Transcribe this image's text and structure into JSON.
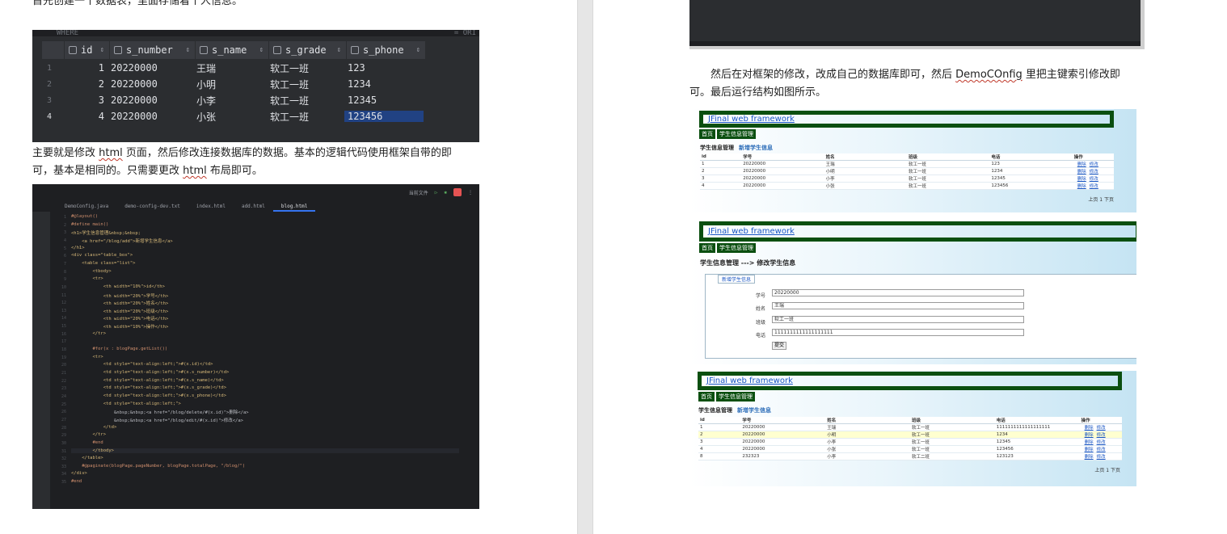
{
  "left_page": {
    "intro_text": "首先创建一个数据表，里面存储着个人信息。",
    "db_table": {
      "toolbar_text": "WHERE",
      "toolbar_right": "= ORI",
      "columns": [
        "id",
        "s_number",
        "s_name",
        "s_grade",
        "s_phone"
      ],
      "rows": [
        {
          "row": "1",
          "id": "1",
          "s_number": "20220000",
          "s_name": "王瑞",
          "s_grade": "软工一班",
          "s_phone": "123"
        },
        {
          "row": "2",
          "id": "2",
          "s_number": "20220000",
          "s_name": "小明",
          "s_grade": "软工一班",
          "s_phone": "1234"
        },
        {
          "row": "3",
          "id": "3",
          "s_number": "20220000",
          "s_name": "小李",
          "s_grade": "软工一班",
          "s_phone": "12345"
        },
        {
          "row": "4",
          "id": "4",
          "s_number": "20220000",
          "s_name": "小张",
          "s_grade": "软工一班",
          "s_phone": "123456"
        }
      ]
    },
    "para2": {
      "a": "主要就是修改 ",
      "b": "html",
      "c": " 页面，然后修改连接数据库的数据。基本的逻辑代码使用框架自带的即",
      "d": "可，基本是相同的。只需要更改 ",
      "e": "html",
      "f": " 布局即可。"
    },
    "ide": {
      "run_label": "当前文件",
      "tabs": [
        "DemoConfig.java",
        "demo-config-dev.txt",
        "index.html",
        "add.html",
        "blog.html"
      ],
      "lines": [
        "#@layout()",
        "#define main()",
        "<h1>学生信息管理&nbsp;&nbsp;",
        "    <a href=\"/blog/add\">新增学生信息</a>",
        "</h1>",
        "<div class=\"table_box\">",
        "    <table class=\"list\">",
        "        <tbody>",
        "        <tr>",
        "            <th width=\"10%\">id</th>",
        "            <th width=\"20%\">学号</th>",
        "            <th width=\"20%\">姓名</th>",
        "            <th width=\"20%\">班级</th>",
        "            <th width=\"20%\">电话</th>",
        "            <th width=\"10%\">操作</th>",
        "        </tr>",
        "",
        "        #for(x : blogPage.getList())",
        "        <tr>",
        "            <td style=\"text-align:left;\">#(x.id)</td>",
        "            <td style=\"text-align:left;\">#(x.s_number)</td>",
        "            <td style=\"text-align:left;\">#(x.s_name)</td>",
        "            <td style=\"text-align:left;\">#(x.s_grade)</td>",
        "            <td style=\"text-align:left;\">#(x.s_phone)</td>",
        "            <td style=\"text-align:left;\">",
        "                &nbsp;&nbsp;<a href=\"/blog/delete/#(x.id)\">删除</a>",
        "                &nbsp;&nbsp;<a href=\"/blog/edit/#(x.id)\">修改</a>",
        "            </td>",
        "        </tr>",
        "        #end",
        "        </tbody>",
        "    </table>",
        "    #@paginate(blogPage.pageNumber, blogPage.totalPage, \"/blog/\")",
        "</div>",
        "#end"
      ]
    }
  },
  "right_page": {
    "para": {
      "a": "然后在对框架的修改，改成自己的数据库即可，然后 ",
      "b": "DemoCOnfig",
      "c": " 里把主键索引修改即",
      "d": "可。最后运行结构如图所示。"
    },
    "brand": "JFinal web framework",
    "nav": [
      "首页",
      "学生信息管理"
    ],
    "list_title": "学生信息管理",
    "add_link": "新增学生信息",
    "headers": [
      "id",
      "学号",
      "姓名",
      "班级",
      "电话",
      "操作"
    ],
    "ops_delete": "删除",
    "ops_edit": "修改",
    "pager": "上页 1 下页",
    "shot1_rows": [
      [
        "1",
        "20220000",
        "王瑞",
        "软工一班",
        "123"
      ],
      [
        "2",
        "20220000",
        "小明",
        "软工一班",
        "1234"
      ],
      [
        "3",
        "20220000",
        "小李",
        "软工一班",
        "12345"
      ],
      [
        "4",
        "20220000",
        "小张",
        "软工一班",
        "123456"
      ]
    ],
    "edit_title": "学生信息管理 ---> 修改学生信息",
    "form": {
      "legend": "新增学生信息",
      "labels": [
        "学号",
        "姓名",
        "班级",
        "电话"
      ],
      "values": [
        "20220000",
        "王瑞",
        "软工一班",
        "1111111111111111111"
      ],
      "submit": "提交"
    },
    "shot3_rows": [
      [
        "1",
        "20220000",
        "王瑞",
        "软工一班",
        "1111111111111111111"
      ],
      [
        "2",
        "20220000",
        "小明",
        "软工一班",
        "1234"
      ],
      [
        "3",
        "20220000",
        "小李",
        "软工一班",
        "12345"
      ],
      [
        "4",
        "20220000",
        "小张",
        "软工一班",
        "123456"
      ],
      [
        "8",
        "232323",
        "小李",
        "软工二班",
        "123123"
      ]
    ]
  }
}
